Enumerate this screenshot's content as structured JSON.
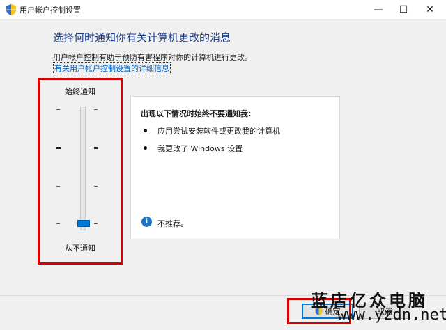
{
  "window": {
    "title": "用户帐户控制设置",
    "minimize_glyph": "—",
    "maximize_glyph": "☐",
    "close_glyph": "✕",
    "icon": "uac-shield-icon"
  },
  "header": {
    "title": "选择何时通知你有关计算机更改的消息",
    "description": "用户帐户控制有助于预防有害程序对你的计算机进行更改。",
    "link": "有关用户帐户控制设置的详细信息"
  },
  "slider": {
    "top_label": "始终通知",
    "bottom_label": "从不通知",
    "levels": 4,
    "selected_level": 1
  },
  "info_panel": {
    "heading": "出现以下情况时始终不要通知我:",
    "bullets": [
      "应用尝试安装软件或更改我的计算机",
      "我更改了 Windows 设置"
    ],
    "note": "不推荐。",
    "note_icon": "info-icon"
  },
  "buttons": {
    "ok": "确定",
    "cancel": "取消"
  },
  "watermark": {
    "text": "蓝店亿众电脑",
    "url": "www.yzdn.net"
  },
  "colors": {
    "accent": "#0078d7",
    "heading": "#1c3f8a",
    "highlight": "#d90000"
  }
}
